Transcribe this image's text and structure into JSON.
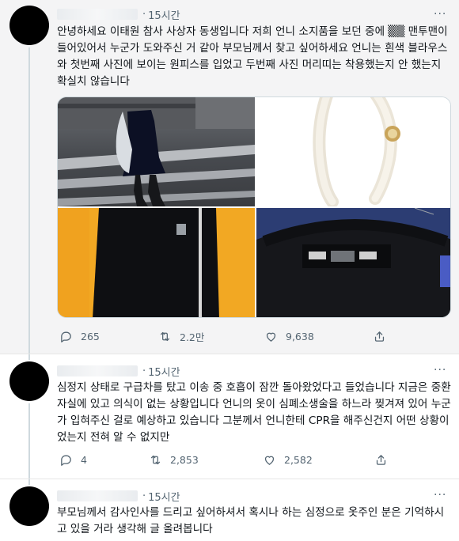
{
  "tweets": [
    {
      "time": "15시간",
      "text": "안녕하세요 이태원 참사 사상자 동생입니다 저희 언니 소지품을 보던 중에 ▒▒ 맨투맨이 들어있어서 누군가 도와주신 거 같아 부모님께서 찾고 싶어하세요 언니는 흰색 블라우스와 첫번째 사진에 보이는 원피스를 입었고 두번째 사진 머리띠는 착용했는지 안 했는지 확실치 않습니다",
      "replies": "265",
      "retweets": "2.2만",
      "likes": "9,638"
    },
    {
      "time": "15시간",
      "text": "심정지 상태로 구급차를 탔고 이송 중 호흡이 잠깐 돌아왔었다고 들었습니다 지금은 중환자실에 있고 의식이 없는 상황입니다 언니의 옷이 심폐소생술을 하느라 찢겨져 있어 누군가 입혀주신 걸로 예상하고 있습니다 그분께서 언니한테 CPR을 해주신건지 어떤 상황이었는지 전혀 알 수 없지만",
      "replies": "4",
      "retweets": "2,853",
      "likes": "2,582"
    },
    {
      "time": "15시간",
      "text": "부모님께서 감사인사를 드리고 싶어하셔서 혹시나 하는 심정으로 옷주인 분은 기억하시고 있을 거라 생각해 글 올려봅니다"
    }
  ],
  "more_label": "···",
  "dot": "·",
  "colors": {
    "text": "#0f1419",
    "muted": "#536471",
    "highlight_bg": "#f4f4f5",
    "sweatshirt_bg": "#f2a823"
  }
}
